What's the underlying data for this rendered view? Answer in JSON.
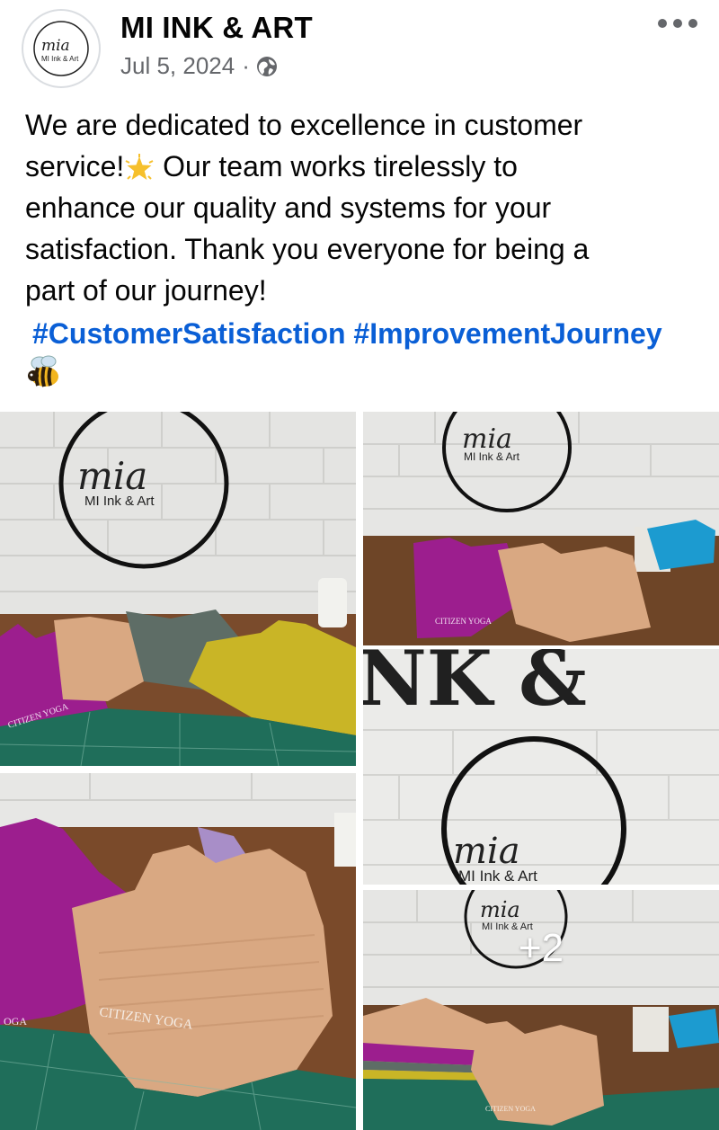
{
  "post": {
    "page_name": "MI INK & ART",
    "date": "Jul 5, 2024",
    "separator": "·",
    "privacy_icon": "globe-icon",
    "menu_icon": "more-horizontal-icon",
    "text_1": "We are dedicated to excellence in customer",
    "text_2a": "service!",
    "text_2b": " Our team works tirelessly to",
    "text_3": "enhance our quality and systems for your",
    "text_4": "satisfaction. Thank you everyone for being a",
    "text_5": "part of our journey!",
    "emoji_1": "glowing-star-emoji",
    "emoji_2": "honeybee-emoji",
    "hashtags": [
      "#CustomerSatisfaction",
      "#ImprovementJourney"
    ]
  },
  "avatar": {
    "script": "mia",
    "subtitle": "MI Ink & Art"
  },
  "photos": {
    "logo_script": "mia",
    "logo_subtitle": "MI Ink & Art",
    "sign_letters": "NK &",
    "garment_brand": "CITIZEN YOGA",
    "garment_brand_short": "OGA",
    "more_count": "+2"
  },
  "colors": {
    "link": "#0a5fd6",
    "secondary_text": "#65676b",
    "magenta_top": "#9c1e8e",
    "tan_top": "#d9a882",
    "gray_top": "#5e6d66",
    "yellow_top": "#c9b526",
    "mat_green": "#1f6e5a"
  }
}
